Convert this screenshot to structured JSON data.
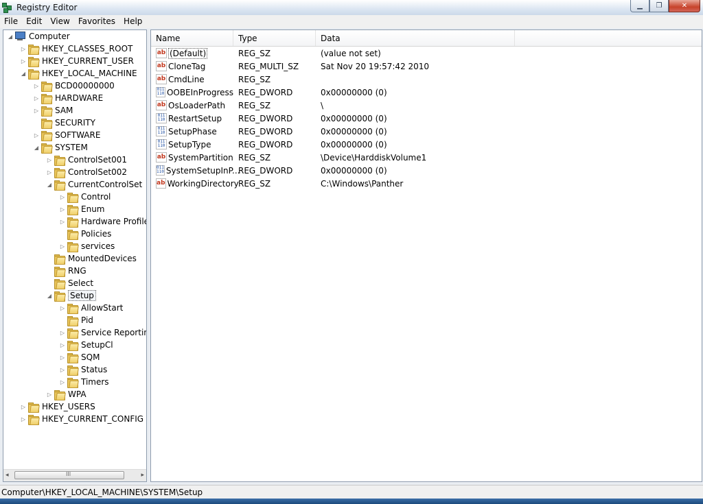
{
  "window": {
    "title": "Registry Editor",
    "min_icon": "minimize-icon",
    "max_icon": "maximize-icon",
    "close_icon": "close-icon"
  },
  "menu": [
    "File",
    "Edit",
    "View",
    "Favorites",
    "Help"
  ],
  "tree": [
    {
      "label": "Computer",
      "depth": 0,
      "exp": "open",
      "icon": "computer-icon"
    },
    {
      "label": "HKEY_CLASSES_ROOT",
      "depth": 1,
      "exp": "closed",
      "icon": "folder-icon"
    },
    {
      "label": "HKEY_CURRENT_USER",
      "depth": 1,
      "exp": "closed",
      "icon": "folder-icon"
    },
    {
      "label": "HKEY_LOCAL_MACHINE",
      "depth": 1,
      "exp": "open",
      "icon": "folder-icon"
    },
    {
      "label": "BCD00000000",
      "depth": 2,
      "exp": "closed",
      "icon": "folder-icon"
    },
    {
      "label": "HARDWARE",
      "depth": 2,
      "exp": "closed",
      "icon": "folder-icon"
    },
    {
      "label": "SAM",
      "depth": 2,
      "exp": "closed",
      "icon": "folder-icon"
    },
    {
      "label": "SECURITY",
      "depth": 2,
      "exp": "none",
      "icon": "folder-icon"
    },
    {
      "label": "SOFTWARE",
      "depth": 2,
      "exp": "closed",
      "icon": "folder-icon"
    },
    {
      "label": "SYSTEM",
      "depth": 2,
      "exp": "open",
      "icon": "folder-icon"
    },
    {
      "label": "ControlSet001",
      "depth": 3,
      "exp": "closed",
      "icon": "folder-icon"
    },
    {
      "label": "ControlSet002",
      "depth": 3,
      "exp": "closed",
      "icon": "folder-icon"
    },
    {
      "label": "CurrentControlSet",
      "depth": 3,
      "exp": "open",
      "icon": "folder-icon"
    },
    {
      "label": "Control",
      "depth": 4,
      "exp": "closed",
      "icon": "folder-icon"
    },
    {
      "label": "Enum",
      "depth": 4,
      "exp": "closed",
      "icon": "folder-icon"
    },
    {
      "label": "Hardware Profiles",
      "depth": 4,
      "exp": "closed",
      "icon": "folder-icon"
    },
    {
      "label": "Policies",
      "depth": 4,
      "exp": "none",
      "icon": "folder-icon"
    },
    {
      "label": "services",
      "depth": 4,
      "exp": "closed",
      "icon": "folder-icon"
    },
    {
      "label": "MountedDevices",
      "depth": 3,
      "exp": "none",
      "icon": "folder-icon"
    },
    {
      "label": "RNG",
      "depth": 3,
      "exp": "none",
      "icon": "folder-icon"
    },
    {
      "label": "Select",
      "depth": 3,
      "exp": "none",
      "icon": "folder-icon"
    },
    {
      "label": "Setup",
      "depth": 3,
      "exp": "open",
      "icon": "folder-icon",
      "selected": true
    },
    {
      "label": "AllowStart",
      "depth": 4,
      "exp": "closed",
      "icon": "folder-icon"
    },
    {
      "label": "Pid",
      "depth": 4,
      "exp": "none",
      "icon": "folder-icon"
    },
    {
      "label": "Service Reporting",
      "depth": 4,
      "exp": "closed",
      "icon": "folder-icon"
    },
    {
      "label": "SetupCl",
      "depth": 4,
      "exp": "closed",
      "icon": "folder-icon"
    },
    {
      "label": "SQM",
      "depth": 4,
      "exp": "closed",
      "icon": "folder-icon"
    },
    {
      "label": "Status",
      "depth": 4,
      "exp": "closed",
      "icon": "folder-icon"
    },
    {
      "label": "Timers",
      "depth": 4,
      "exp": "closed",
      "icon": "folder-icon"
    },
    {
      "label": "WPA",
      "depth": 3,
      "exp": "closed",
      "icon": "folder-icon"
    },
    {
      "label": "HKEY_USERS",
      "depth": 1,
      "exp": "closed",
      "icon": "folder-icon"
    },
    {
      "label": "HKEY_CURRENT_CONFIG",
      "depth": 1,
      "exp": "closed",
      "icon": "folder-icon"
    }
  ],
  "tree_scrollbar": {
    "left_arrow": "◂",
    "right_arrow": "▸",
    "grip": "III"
  },
  "columns": [
    "Name",
    "Type",
    "Data"
  ],
  "values": [
    {
      "name": "(Default)",
      "type": "REG_SZ",
      "data": "(value not set)",
      "icon": "string-value-icon",
      "focus": true
    },
    {
      "name": "CloneTag",
      "type": "REG_MULTI_SZ",
      "data": "Sat Nov 20 19:57:42 2010",
      "icon": "string-value-icon"
    },
    {
      "name": "CmdLine",
      "type": "REG_SZ",
      "data": "",
      "icon": "string-value-icon"
    },
    {
      "name": "OOBEInProgress",
      "type": "REG_DWORD",
      "data": "0x00000000 (0)",
      "icon": "binary-value-icon"
    },
    {
      "name": "OsLoaderPath",
      "type": "REG_SZ",
      "data": "\\",
      "icon": "string-value-icon"
    },
    {
      "name": "RestartSetup",
      "type": "REG_DWORD",
      "data": "0x00000000 (0)",
      "icon": "binary-value-icon"
    },
    {
      "name": "SetupPhase",
      "type": "REG_DWORD",
      "data": "0x00000000 (0)",
      "icon": "binary-value-icon"
    },
    {
      "name": "SetupType",
      "type": "REG_DWORD",
      "data": "0x00000000 (0)",
      "icon": "binary-value-icon"
    },
    {
      "name": "SystemPartition",
      "type": "REG_SZ",
      "data": "\\Device\\HarddiskVolume1",
      "icon": "string-value-icon"
    },
    {
      "name": "SystemSetupInP...",
      "type": "REG_DWORD",
      "data": "0x00000000 (0)",
      "icon": "binary-value-icon"
    },
    {
      "name": "WorkingDirectory",
      "type": "REG_SZ",
      "data": "C:\\Windows\\Panther",
      "icon": "string-value-icon"
    }
  ],
  "status": "Computer\\HKEY_LOCAL_MACHINE\\SYSTEM\\Setup"
}
